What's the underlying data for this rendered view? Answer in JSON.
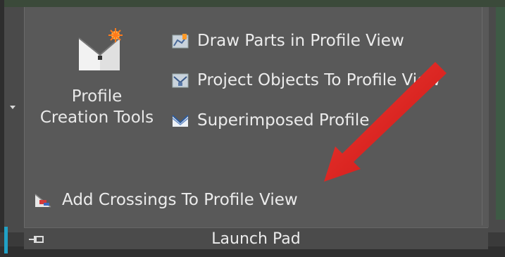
{
  "ribbon_panel": {
    "big_button": {
      "line1": "Profile",
      "line2": "Creation Tools",
      "icon": "profile-creation-icon"
    },
    "commands": [
      {
        "label": "Draw Parts in Profile View",
        "icon": "draw-parts-icon"
      },
      {
        "label": "Project Objects To Profile View",
        "icon": "project-objects-icon"
      },
      {
        "label": "Superimposed Profile",
        "icon": "superimposed-profile-icon"
      }
    ],
    "expanded_item": {
      "label": "Add Crossings To Profile View",
      "icon": "add-crossings-icon"
    },
    "panel_title": "Launch Pad"
  },
  "colors": {
    "panel_bg": "#595959",
    "text": "#ececec",
    "annotation_arrow": "#e01b1b",
    "accent_blue": "#21a1c6"
  }
}
